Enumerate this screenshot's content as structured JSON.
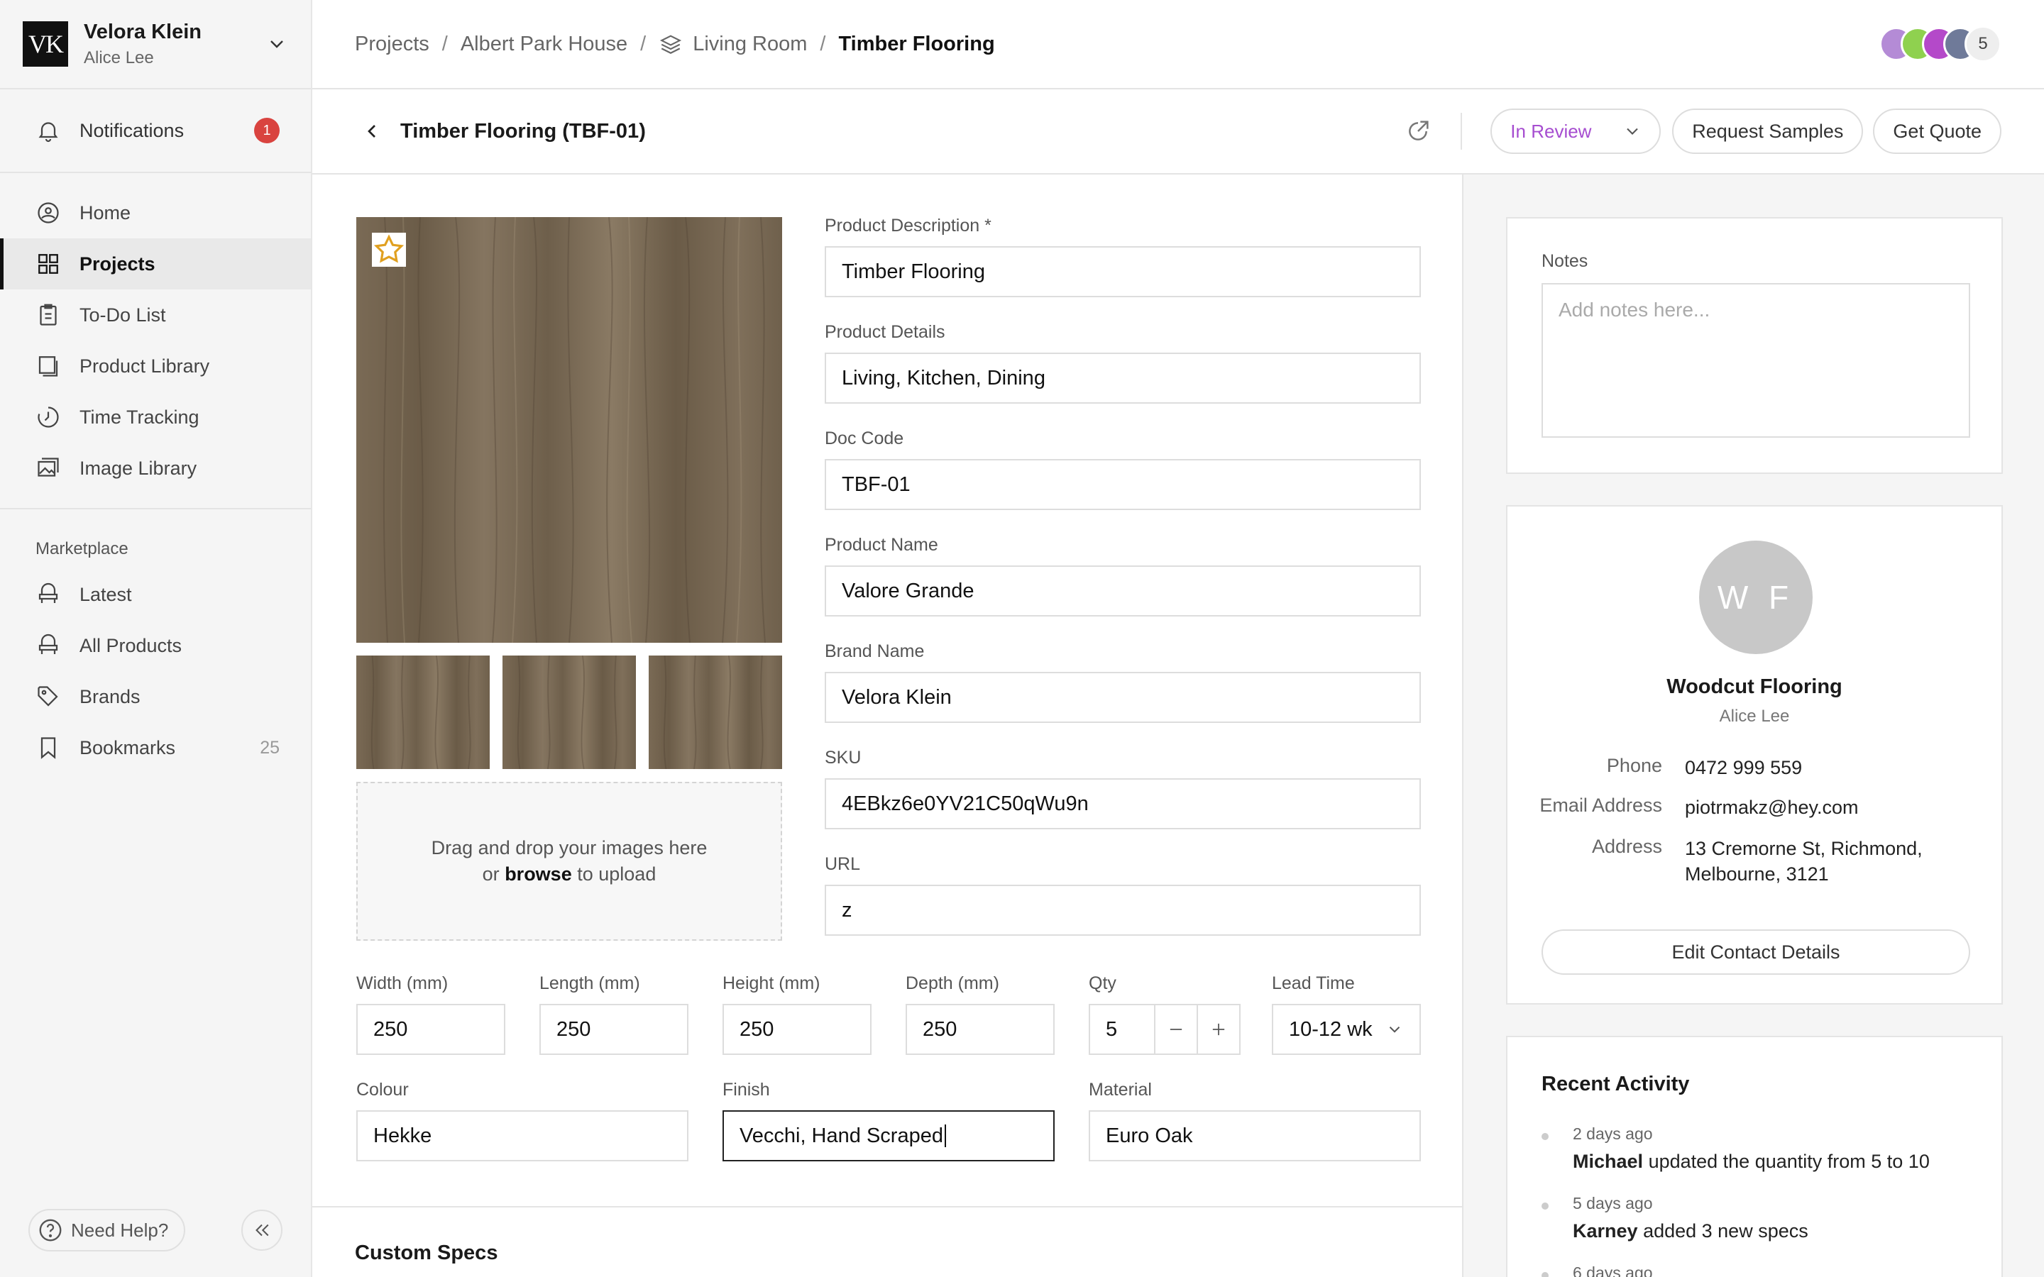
{
  "sidebar": {
    "logo_text": "VK",
    "org_name": "Velora Klein",
    "user_name": "Alice Lee",
    "notifications": {
      "label": "Notifications",
      "count": "1"
    },
    "nav": [
      {
        "label": "Home",
        "icon": "home-icon"
      },
      {
        "label": "Projects",
        "icon": "grid-icon",
        "active": true
      },
      {
        "label": "To-Do List",
        "icon": "clipboard-icon"
      },
      {
        "label": "Product Library",
        "icon": "book-icon"
      },
      {
        "label": "Time Tracking",
        "icon": "clock-icon"
      },
      {
        "label": "Image Library",
        "icon": "image-icon"
      }
    ],
    "marketplace_title": "Marketplace",
    "marketplace": [
      {
        "label": "Latest",
        "icon": "chair-icon"
      },
      {
        "label": "All Products",
        "icon": "chair-icon"
      },
      {
        "label": "Brands",
        "icon": "tag-icon"
      },
      {
        "label": "Bookmarks",
        "icon": "bookmark-icon",
        "count": "25"
      }
    ],
    "help_label": "Need Help?"
  },
  "header": {
    "breadcrumbs": [
      "Projects",
      "Albert Park House",
      "Living Room",
      "Timber Flooring"
    ],
    "separator": "/",
    "avatar_count": "5"
  },
  "titlebar": {
    "title": "Timber Flooring (TBF-01)",
    "status": "In Review",
    "request_samples": "Request Samples",
    "get_quote": "Get Quote"
  },
  "gallery": {
    "drop_line1": "Drag and drop your images here",
    "drop_or": "or",
    "drop_browse": "browse",
    "drop_to_upload": "to upload"
  },
  "form": {
    "product_description": {
      "label": "Product Description *",
      "value": "Timber Flooring"
    },
    "product_details": {
      "label": "Product Details",
      "value": "Living, Kitchen, Dining"
    },
    "doc_code": {
      "label": "Doc Code",
      "value": "TBF-01"
    },
    "product_name": {
      "label": "Product Name",
      "value": "Valore Grande"
    },
    "brand_name": {
      "label": "Brand Name",
      "value": "Velora Klein"
    },
    "sku": {
      "label": "SKU",
      "value": "4EBkz6e0YV21C50qWu9n"
    },
    "url": {
      "label": "URL",
      "value": "z"
    },
    "width": {
      "label": "Width (mm)",
      "value": "250"
    },
    "length": {
      "label": "Length (mm)",
      "value": "250"
    },
    "height": {
      "label": "Height (mm)",
      "value": "250"
    },
    "depth": {
      "label": "Depth (mm)",
      "value": "250"
    },
    "qty": {
      "label": "Qty",
      "value": "5"
    },
    "lead_time": {
      "label": "Lead Time",
      "value": "10-12 wk"
    },
    "colour": {
      "label": "Colour",
      "value": "Hekke"
    },
    "finish": {
      "label": "Finish",
      "value": "Vecchi, Hand Scraped"
    },
    "material": {
      "label": "Material",
      "value": "Euro Oak"
    }
  },
  "custom_specs_title": "Custom Specs",
  "notes": {
    "title": "Notes",
    "placeholder": "Add notes here..."
  },
  "contact": {
    "initials": "W F",
    "company": "Woodcut Flooring",
    "person": "Alice Lee",
    "phone_label": "Phone",
    "phone": "0472 999 559",
    "email_label": "Email Address",
    "email": "piotrmakz@hey.com",
    "address_label": "Address",
    "address_line1": "13 Cremorne St, Richmond,",
    "address_line2": "Melbourne, 3121",
    "edit_label": "Edit Contact Details"
  },
  "activity": {
    "title": "Recent Activity",
    "items": [
      {
        "time": "2 days ago",
        "who": "Michael",
        "text": "updated the quantity from 5 to 10"
      },
      {
        "time": "5 days ago",
        "who": "Karney",
        "text": "added 3 new specs"
      },
      {
        "time": "6 days ago"
      }
    ]
  },
  "colors": {
    "status": "#a64dd0",
    "notification_badge": "#d9433f",
    "star": "#e0a020"
  }
}
